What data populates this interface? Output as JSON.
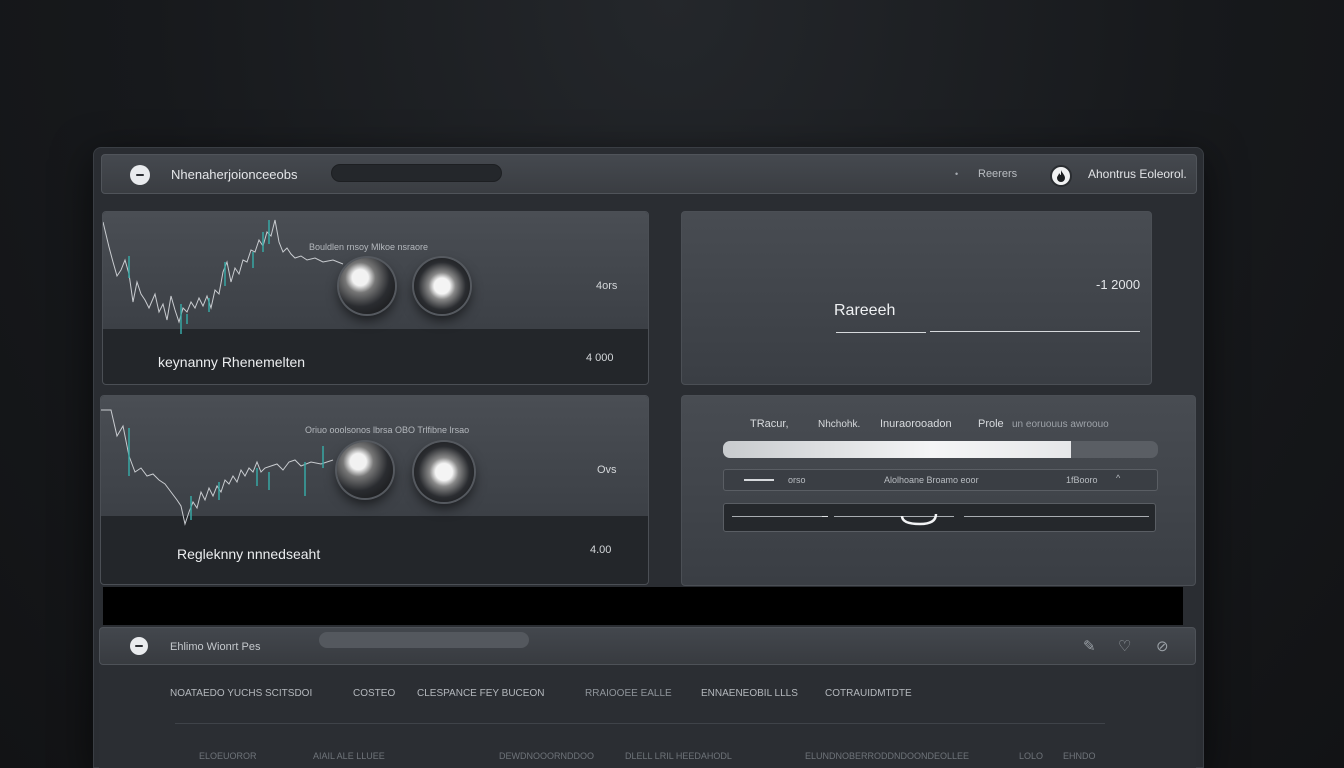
{
  "header": {
    "title": "Nhenaherjoionceeobs",
    "search_placeholder": "",
    "right_label": "Reerers",
    "account_icon": "flame-icon",
    "account_name": "Ahontrus Eoleorol."
  },
  "cards": [
    {
      "overlay_text": "Bouldlen rnsoy Mlkoe nsraore",
      "value_top": "4ors",
      "value_bottom": "4 000",
      "label": "keynanny Rhenemelten"
    },
    {
      "overlay_text": "Oriuo ooolsonos lbrsa OBO Trlfibne lrsao",
      "value_top": "Ovs",
      "value_bottom": "4.00",
      "label": "Regleknny nnnedseaht"
    }
  ],
  "research_card": {
    "title": "Rareeeh",
    "value": "-1 2000"
  },
  "progress_card": {
    "header_items": [
      "TRacur,",
      "Nhchohk.",
      "Inuraorooadon",
      "Prole",
      "un eoruouus awroouo"
    ],
    "progress": 0.8,
    "row": {
      "left": "orso",
      "middle": "Alolhoane Broamo eoor",
      "right": "1fBooro"
    }
  },
  "bottombar": {
    "title": "Ehlimo Wionrt Pes",
    "icons": [
      "pencil-icon",
      "heart-icon",
      "link-icon"
    ]
  },
  "table": {
    "columns": [
      "NOATAEDO YUCHS SCITSDOI",
      "COSTEO",
      "CLESPANCE FEY BUCEON",
      "RRAIOOEE EALLE",
      "ENNAENEOBIL LLLS",
      "COTRAUIDMTDTE"
    ],
    "row": [
      "ELOEUOROR",
      "AIAIL ALE LLUEE",
      "DEWDNOOORNDDOO",
      "DLELL LRIL HEEDAHODL",
      "ELUNDNOBERRODDNDOONDEOLLEE",
      "LOLO",
      "EHNDO"
    ]
  },
  "colors": {
    "accent_teal": "#37a7a4",
    "background": "#17191c",
    "panel": "#3c4046"
  }
}
